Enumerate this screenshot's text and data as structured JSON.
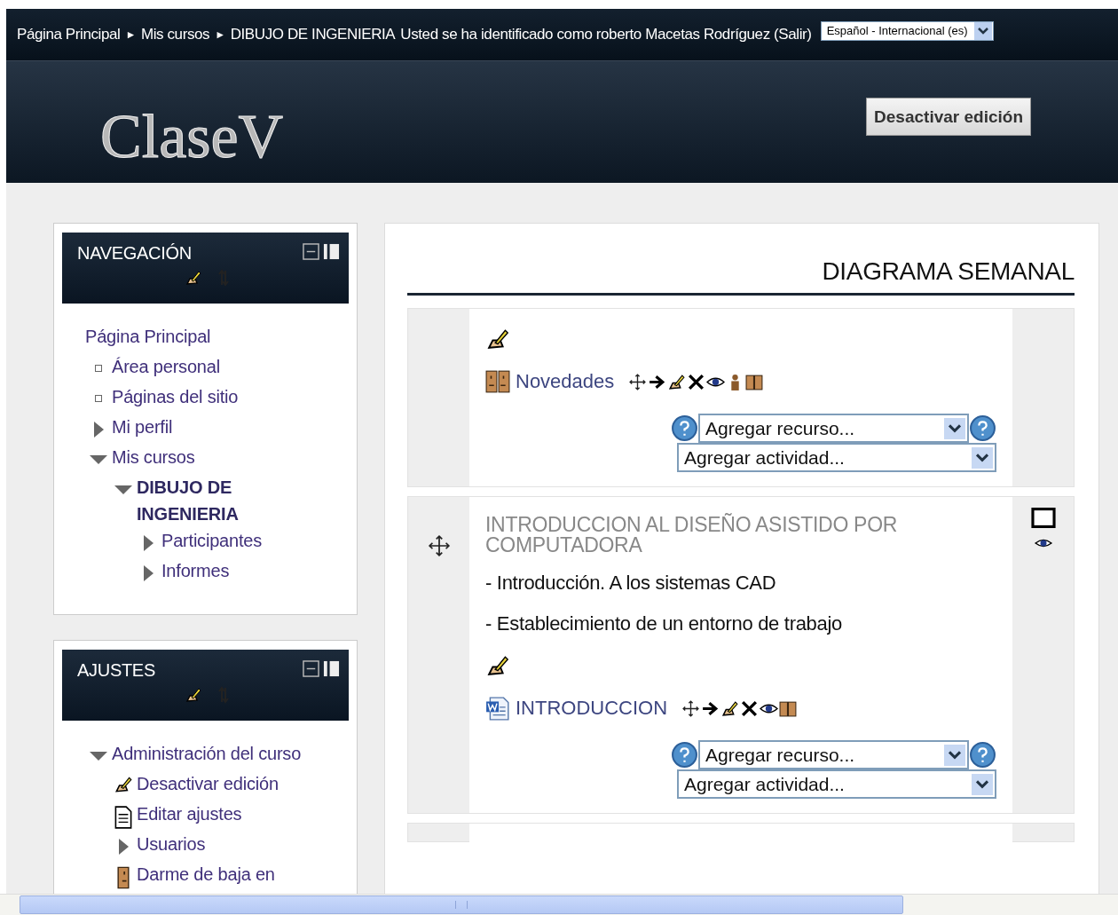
{
  "top_bar": {
    "breadcrumb": [
      {
        "label": "Página Principal"
      },
      {
        "label": "Mis cursos"
      },
      {
        "label": "DIBUJO DE INGENIERIA"
      }
    ],
    "separator": "►",
    "login_text": "Usted se ha identificado como roberto Macetas Rodríguez (Salir)",
    "language": "Español - Internacional (es)"
  },
  "header": {
    "logo": "ClaseV",
    "edit_button": "Desactivar edición"
  },
  "blocks": [
    {
      "title": "NAVEGACIÓN",
      "items": [
        {
          "label": "Página Principal",
          "kind": "root",
          "children": [
            {
              "label": "Área personal",
              "kind": "leaf"
            },
            {
              "label": "Páginas del sitio",
              "kind": "leaf"
            },
            {
              "label": "Mi perfil",
              "kind": "branch",
              "expanded": false
            },
            {
              "label": "Mis cursos",
              "kind": "branch",
              "expanded": true,
              "children": [
                {
                  "label": "DIBUJO DE INGENIERIA",
                  "kind": "branch",
                  "expanded": true,
                  "bold": true,
                  "children": [
                    {
                      "label": "Participantes",
                      "kind": "branch",
                      "expanded": false
                    },
                    {
                      "label": "Informes",
                      "kind": "branch",
                      "expanded": false
                    }
                  ]
                }
              ]
            }
          ]
        }
      ]
    },
    {
      "title": "AJUSTES",
      "items": [
        {
          "label": "Administración del curso",
          "kind": "branch",
          "expanded": true,
          "children": [
            {
              "label": "Desactivar edición",
              "kind": "edit"
            },
            {
              "label": "Editar ajustes",
              "kind": "page"
            },
            {
              "label": "Usuarios",
              "kind": "branch",
              "expanded": false
            },
            {
              "label": "Darme de baja en",
              "kind": "person"
            }
          ]
        }
      ]
    }
  ],
  "main": {
    "heading": "DIAGRAMA SEMANAL",
    "sections": [
      {
        "activities": [
          {
            "label": "Novedades",
            "kind": "forum",
            "tools": [
              {
                "kind": "move"
              },
              {
                "kind": "indent"
              },
              {
                "kind": "edit"
              },
              {
                "kind": "delete"
              },
              {
                "kind": "hide"
              },
              {
                "kind": "role"
              },
              {
                "kind": "groups"
              }
            ]
          }
        ],
        "add_resource": "Agregar recurso...",
        "add_activity": "Agregar actividad..."
      },
      {
        "title": "INTRODUCCION AL DISEÑO ASISTIDO POR COMPUTADORA",
        "lines": [
          "- Introducción. A los sistemas CAD",
          "- Establecimiento de un entorno de trabajo"
        ],
        "activities": [
          {
            "label": "INTRODUCCION",
            "kind": "word",
            "tools": [
              {
                "kind": "move"
              },
              {
                "kind": "indent"
              },
              {
                "kind": "edit"
              },
              {
                "kind": "delete"
              },
              {
                "kind": "hide"
              },
              {
                "kind": "groups"
              }
            ]
          }
        ],
        "add_resource": "Agregar recurso...",
        "add_activity": "Agregar actividad..."
      }
    ]
  }
}
